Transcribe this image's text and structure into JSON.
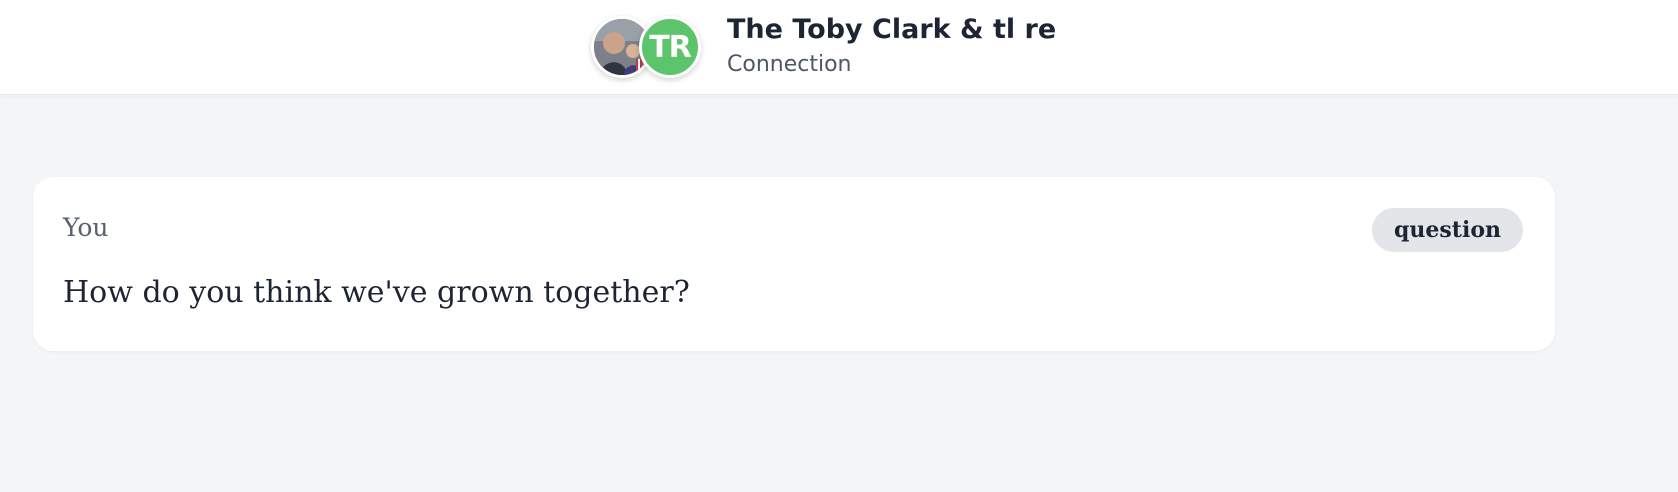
{
  "header": {
    "title": "The Toby Clark & tl re",
    "subtitle": "Connection",
    "avatars": [
      {
        "type": "photo",
        "icon": "user-photo-icon"
      },
      {
        "type": "initials",
        "text": "TR",
        "color": "#5cc46a"
      }
    ]
  },
  "message_card": {
    "author": "You",
    "tag": "question",
    "text": "How do you think we've grown together?"
  },
  "colors": {
    "background": "#f4f5f7",
    "card": "#ffffff",
    "tag_bg": "#e3e5e9",
    "text_primary": "#1d2433",
    "text_secondary": "#596070",
    "avatar_green": "#5cc46a"
  }
}
